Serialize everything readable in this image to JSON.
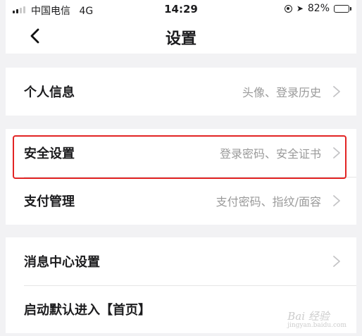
{
  "status_bar": {
    "carrier": "中国电信",
    "network": "4G",
    "time": "14:29",
    "battery": "82%",
    "battery_level": 0.82
  },
  "nav": {
    "title": "设置"
  },
  "groups": [
    {
      "rows": [
        {
          "label": "个人信息",
          "detail": "头像、登录历史"
        }
      ]
    },
    {
      "rows": [
        {
          "label": "安全设置",
          "detail": "登录密码、安全证书"
        },
        {
          "label": "支付管理",
          "detail": "支付密码、指纹/面容"
        }
      ]
    },
    {
      "rows": [
        {
          "label": "消息中心设置",
          "detail": ""
        },
        {
          "label": "启动默认进入【首页】",
          "detail": ""
        }
      ]
    }
  ],
  "watermark": {
    "text": "Bai 经验",
    "sub": "jingyan.baidu.com"
  },
  "colors": {
    "highlight": "#e22424",
    "background": "#f2f2f4"
  }
}
